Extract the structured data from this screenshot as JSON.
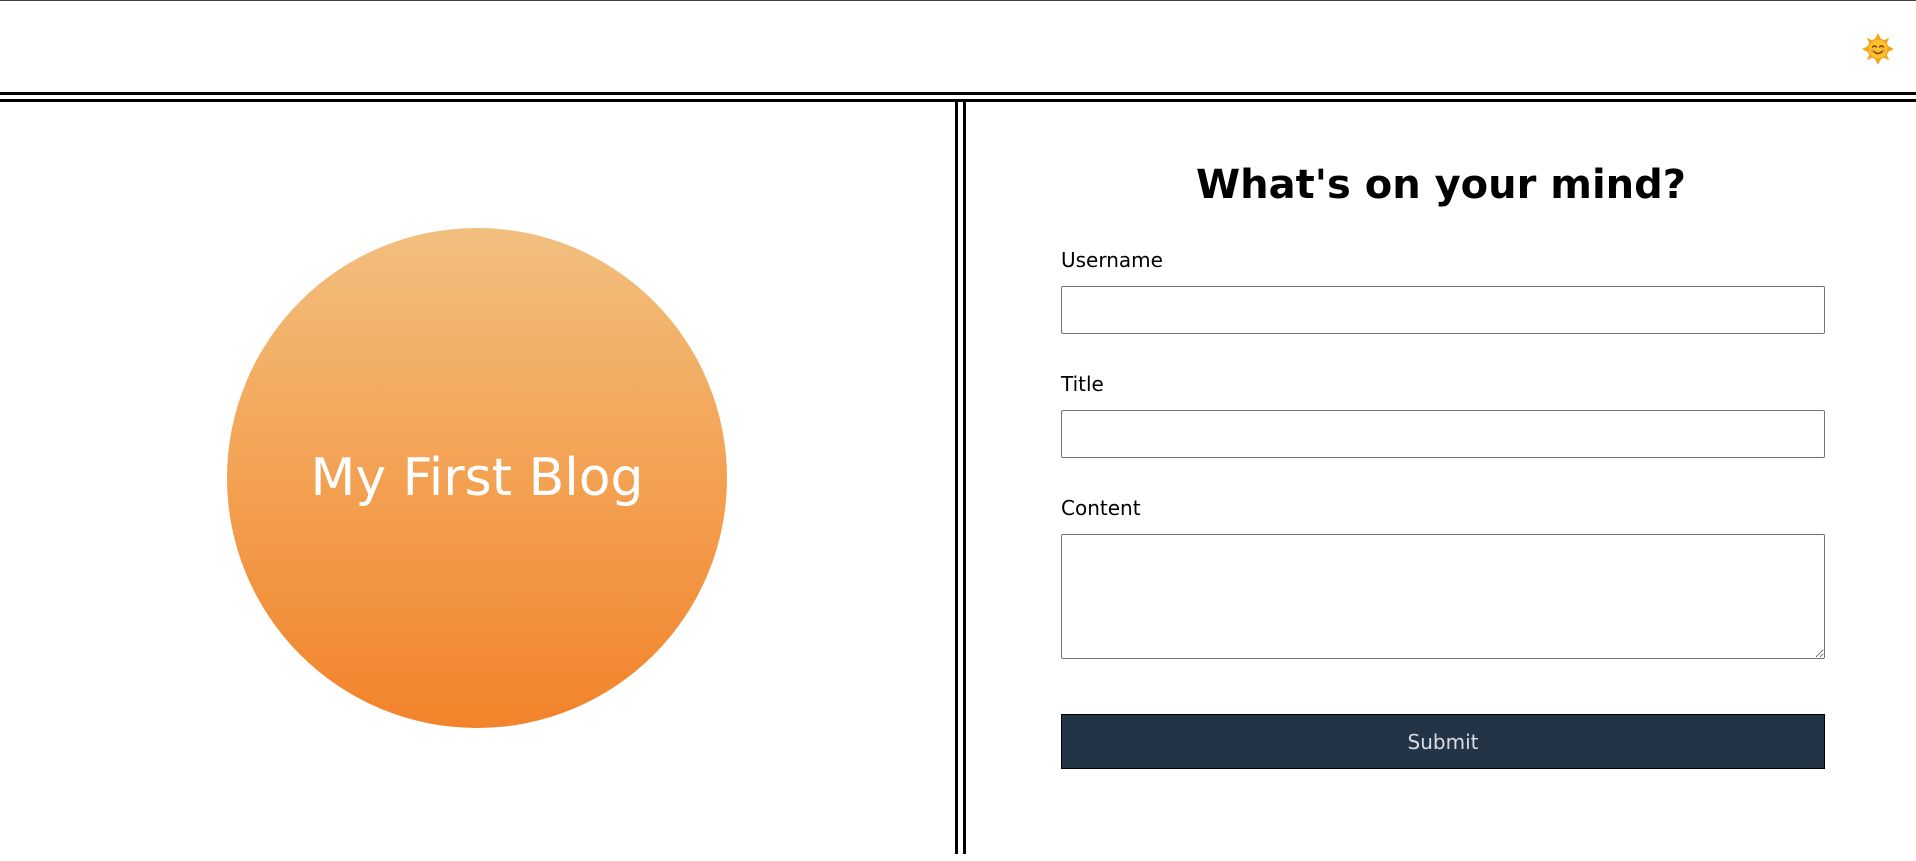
{
  "header": {
    "mode_toggle_icon": "smiling-sun-icon",
    "mode_toggle_glyph": "🌞"
  },
  "hero": {
    "title": "My First Blog",
    "gradient_colors": [
      "#f2bf7f",
      "#f3a152",
      "#f2832a"
    ]
  },
  "form": {
    "heading": "What's on your mind?",
    "username": {
      "label": "Username",
      "value": ""
    },
    "title": {
      "label": "Title",
      "value": ""
    },
    "content": {
      "label": "Content",
      "value": ""
    },
    "submit_label": "Submit",
    "submit_color": "#243447"
  }
}
